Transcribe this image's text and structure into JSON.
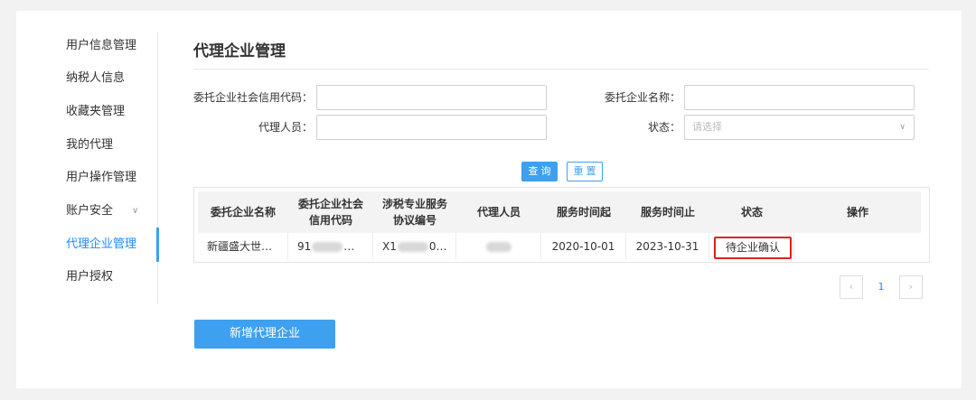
{
  "sidebar": {
    "items": [
      {
        "label": "用户信息管理"
      },
      {
        "label": "纳税人信息"
      },
      {
        "label": "收藏夹管理"
      },
      {
        "label": "我的代理"
      },
      {
        "label": "用户操作管理"
      },
      {
        "label": "账户安全"
      },
      {
        "label": "代理企业管理",
        "active": true
      },
      {
        "label": "用户授权"
      }
    ]
  },
  "page": {
    "title": "代理企业管理"
  },
  "form": {
    "credit_code_label": "委托企业社会信用代码：",
    "company_name_label": "委托企业名称：",
    "agent_label": "代理人员：",
    "status_label": "状态：",
    "status_placeholder": "请选择",
    "query_button": "查询",
    "reset_button": "重置"
  },
  "table": {
    "columns": [
      "委托企业名称",
      "委托企业社会信用代码",
      "涉税专业服务协议编号",
      "代理人员",
      "服务时间起",
      "服务时间止",
      "状态",
      "操作"
    ],
    "rows": [
      {
        "company": "新疆盛大世…",
        "credit_prefix": "91",
        "credit_suffix": "…",
        "agreement_prefix": "X1",
        "agreement_suffix": "0…",
        "start": "2020-10-01",
        "end": "2023-10-31",
        "status": "待企业确认"
      }
    ]
  },
  "pagination": {
    "prev": "‹",
    "current": "1",
    "next": "›"
  },
  "add_button": "新增代理企业",
  "colors": {
    "accent": "#3ea0f0",
    "highlight_border": "#e02020"
  }
}
